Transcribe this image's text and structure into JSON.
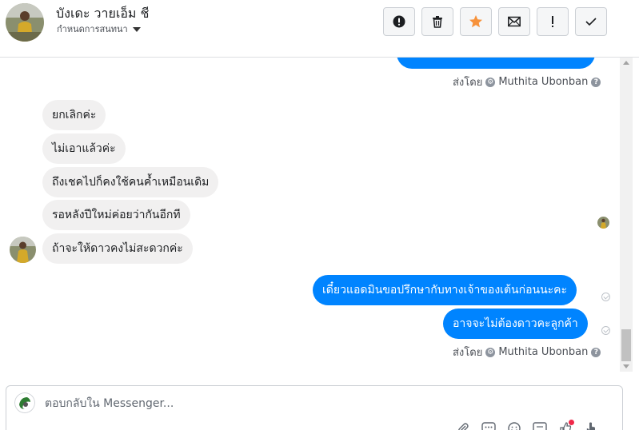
{
  "header": {
    "contact_name": "บังเดะ วายเอ็ม ชี",
    "conversation_settings_label": "กำหนดการสนทนา",
    "actions": [
      {
        "name": "report-button",
        "icon": "alert-circle-icon"
      },
      {
        "name": "delete-button",
        "icon": "trash-icon"
      },
      {
        "name": "star-button",
        "icon": "star-icon",
        "color": "#f7923b"
      },
      {
        "name": "mark-unread-button",
        "icon": "envelope-icon"
      },
      {
        "name": "spam-button",
        "icon": "exclamation-icon"
      },
      {
        "name": "done-button",
        "icon": "checkmark-icon"
      }
    ]
  },
  "conversation": {
    "top_sent_by": {
      "prefix": "ส่งโดย",
      "name": "Muthita Ubonban"
    },
    "incoming": [
      "ยกเลิกค่ะ",
      "ไม่เอาแล้วค่ะ",
      "ถึงเชคไปก็คงใช้คนค้ำเหมือนเดิม",
      "รอหลังปีใหม่ค่อยว่ากันอีกที",
      "ถ้าจะให้ดาวคงไม่สะดวกค่ะ"
    ],
    "outgoing": [
      "เดี๋ยวแอดมินขอปรึกษากับทางเจ้าของเต้นก่อนนะคะ",
      "อาจจะไม่ต้องดาวคะลูกค้า"
    ],
    "bottom_sent_by": {
      "prefix": "ส่งโดย",
      "name": "Muthita Ubonban"
    }
  },
  "composer": {
    "placeholder": "ตอบกลับใน Messenger...",
    "value": ""
  },
  "colors": {
    "outgoing_bubble": "#0084ff",
    "incoming_bubble": "#f1f0f0",
    "notification_dot": "#f02849"
  }
}
